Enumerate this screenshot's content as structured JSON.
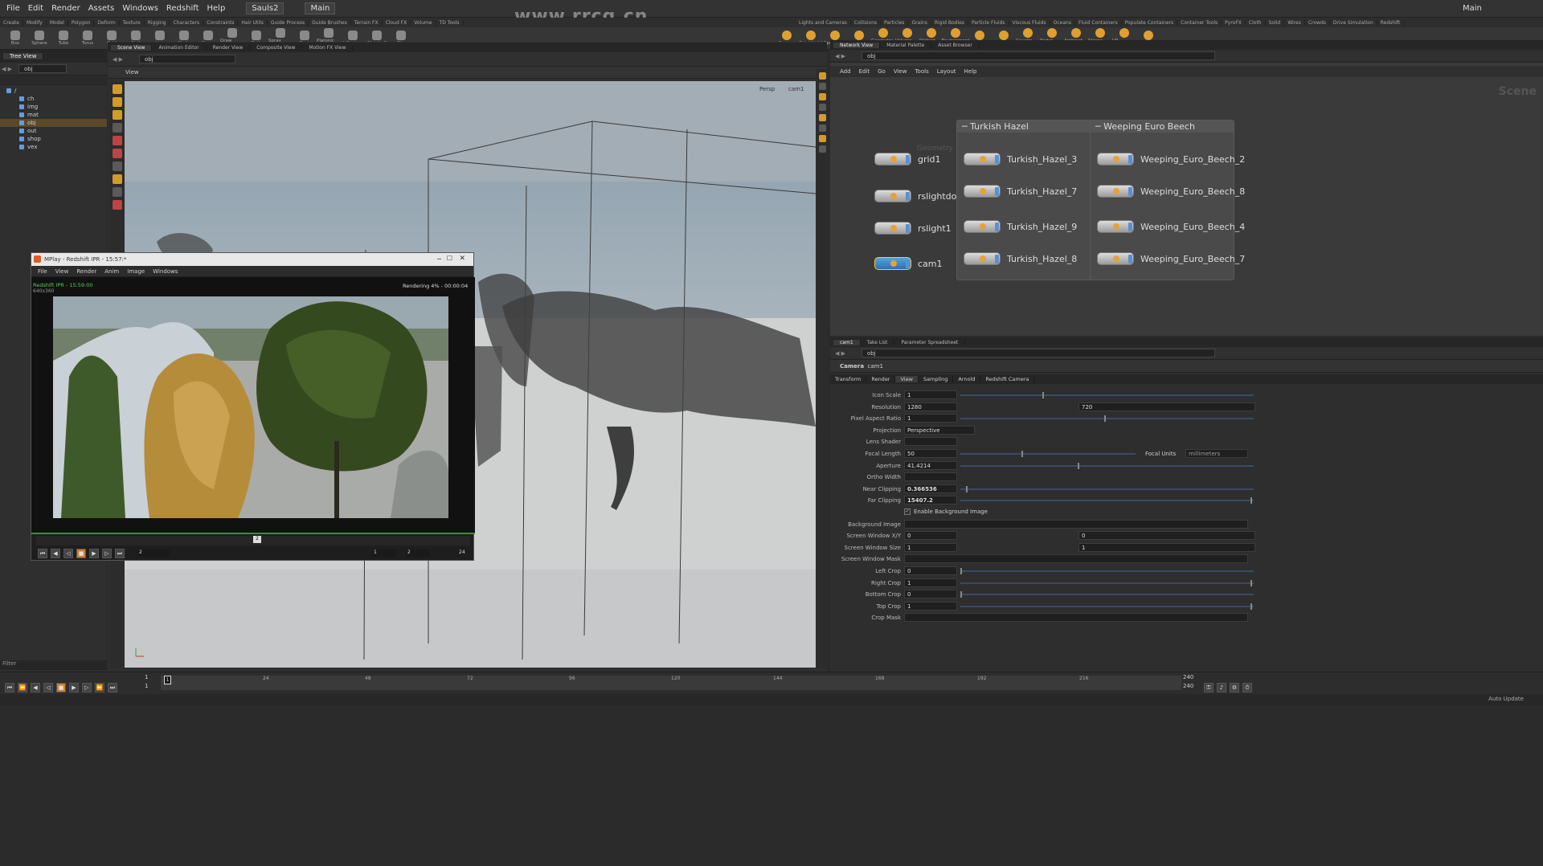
{
  "menu": {
    "items": [
      "File",
      "Edit",
      "Render",
      "Assets",
      "Windows",
      "Redshift",
      "Help"
    ],
    "desktop": "Sauls2",
    "main": "Main",
    "right_desk": "Main"
  },
  "shelf_tabs": [
    "Create",
    "Modify",
    "Model",
    "Polygon",
    "Deform",
    "Texture",
    "Rigging",
    "Characters",
    "Constraints",
    "Hair Utils",
    "Guide Process",
    "Guide Brushes",
    "Terrain FX",
    "Cloud FX",
    "Volume",
    "TD Tools"
  ],
  "shelf_tabs_right": [
    "Lights and Cameras",
    "Collisions",
    "Particles",
    "Grains",
    "Rigid Bodies",
    "Particle Fluids",
    "Viscous Fluids",
    "Oceans",
    "Fluid Containers",
    "Populate Containers",
    "Container Tools",
    "PyroFX",
    "Cloth",
    "Solid",
    "Wires",
    "Crowds",
    "Drive Simulation",
    "Redshift"
  ],
  "shelf_tools": [
    "Box",
    "Sphere",
    "Tube",
    "Torus",
    "Grid",
    "Null",
    "Line",
    "Circle",
    "Curve",
    "Draw Curve",
    "Path",
    "Spray Paint",
    "Font",
    "Platonic Solids",
    "L-System",
    "Metaball",
    "File"
  ],
  "shelf_light_tools": [
    "Camera",
    "Point Light",
    "Spot Light",
    "Area Light",
    "Geometry Light",
    "Volume Light",
    "Distant Light",
    "Environment Light",
    "Sky Light",
    "GI Light",
    "Caustic Light",
    "Portal Light",
    "Ambient Light",
    "Stereo Camera",
    "VR Camera",
    "Switcher"
  ],
  "left_panel": {
    "tab": "Tree View",
    "path": "obj",
    "items": [
      "/",
      "ch",
      "img",
      "mat",
      "obj",
      "out",
      "shop",
      "vex"
    ],
    "filter": "Filter"
  },
  "center_tabs": [
    "Scene View",
    "Animation Editor",
    "Render View",
    "Composite View",
    "Motion FX View"
  ],
  "center_path": "obj",
  "view_label": "View",
  "persp": "Persp",
  "cam": "cam1",
  "ipr": {
    "title": "MPlay - Redshift IPR - 15:57:*",
    "menu": [
      "File",
      "View",
      "Render",
      "Anim",
      "Image",
      "Windows"
    ],
    "status_left": "Redshift IPR - 15:59:00",
    "res": "640x360",
    "rendering": "Rendering 4% - 00:00:04",
    "frame": "2",
    "frame_a": "1",
    "frame_b": "2",
    "frame_end": "24",
    "marker": "2"
  },
  "network": {
    "tabs": [
      "Network View",
      "Material Palette",
      "Asset Browser"
    ],
    "path": "obj",
    "menu": [
      "Add",
      "Edit",
      "Go",
      "View",
      "Tools",
      "Layout",
      "Help"
    ],
    "scene_label": "Scene",
    "geometry_label": "Geometry",
    "nodes": [
      "grid1",
      "rslightdome1",
      "rslight1",
      "cam1"
    ],
    "box1": {
      "title": "Turkish Hazel",
      "nodes": [
        "Turkish_Hazel_3",
        "Turkish_Hazel_7",
        "Turkish_Hazel_9",
        "Turkish_Hazel_8"
      ]
    },
    "box2": {
      "title": "Weeping Euro Beech",
      "nodes": [
        "Weeping_Euro_Beech_2",
        "Weeping_Euro_Beech_8",
        "Weeping_Euro_Beech_4",
        "Weeping_Euro_Beech_7"
      ]
    }
  },
  "params": {
    "tabs": [
      "cam1",
      "Take List",
      "Parameter Spreadsheet"
    ],
    "path": "obj",
    "type": "Camera",
    "name": "cam1",
    "subtabs": [
      "Transform",
      "Render",
      "View",
      "Sampling",
      "Arnold",
      "Redshift Camera"
    ],
    "rows": [
      {
        "label": "Icon Scale",
        "value": "1"
      },
      {
        "label": "Resolution",
        "value": "1280",
        "value2": "720"
      },
      {
        "label": "Pixel Aspect Ratio",
        "value": "1"
      },
      {
        "label": "Projection",
        "value": "Perspective"
      },
      {
        "label": "Lens Shader",
        "value": ""
      },
      {
        "label": "Focal Length",
        "value": "50",
        "extra_label": "Focal Units",
        "extra": "millimeters"
      },
      {
        "label": "Aperture",
        "value": "41.4214"
      },
      {
        "label": "Ortho Width",
        "value": ""
      },
      {
        "label": "Near Clipping",
        "value": "0.366536"
      },
      {
        "label": "Far Clipping",
        "value": "15407.2"
      },
      {
        "label": "",
        "value": "Enable Background Image"
      },
      {
        "label": "Background Image",
        "value": ""
      },
      {
        "label": "Screen Window X/Y",
        "value": "0",
        "value2": "0"
      },
      {
        "label": "Screen Window Size",
        "value": "1",
        "value2": "1"
      },
      {
        "label": "Screen Window Mask",
        "value": ""
      },
      {
        "label": "Left Crop",
        "value": "0"
      },
      {
        "label": "Right Crop",
        "value": "1"
      },
      {
        "label": "Bottom Crop",
        "value": "0"
      },
      {
        "label": "Top Crop",
        "value": "1"
      },
      {
        "label": "Crop Mask",
        "value": ""
      }
    ]
  },
  "timeline": {
    "frame": "1",
    "start": "1",
    "end": "240",
    "end2": "240",
    "ticks": [
      "24",
      "48",
      "72",
      "96",
      "120",
      "144",
      "168",
      "192",
      "216"
    ],
    "auto_update": "Auto Update"
  },
  "watermark": "www.rrcg.cn"
}
